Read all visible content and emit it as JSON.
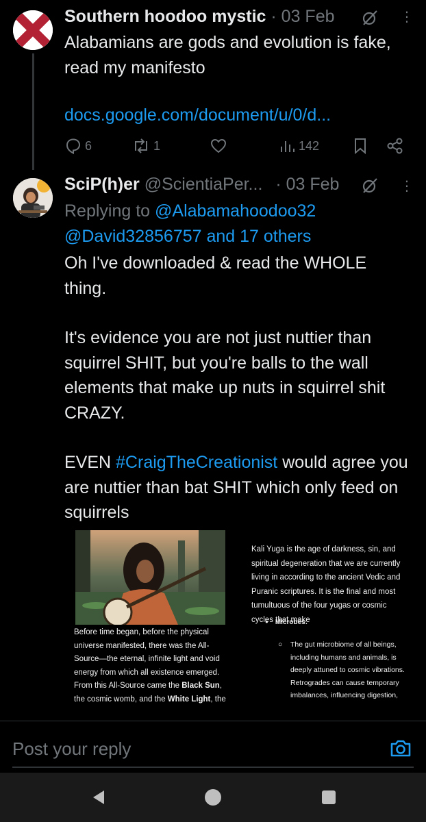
{
  "tweet1": {
    "name": "Southern hoodoo mystic",
    "date": "· 03 Feb",
    "text": "Alabamians are gods and evolution is fake, read my manifesto",
    "link": "docs.google.com/document/u/0/d...",
    "stats": {
      "replies": "6",
      "reposts": "1",
      "views": "142"
    }
  },
  "tweet2": {
    "name": "SciP(h)er",
    "handle": "@ScientiaPer...",
    "date": "· 03 Feb",
    "replying_prefix": "Replying to",
    "replying_to": "@Alabamahoodoo32",
    "replying_more": "@David32856757 and 17 others",
    "body": {
      "p1": "Oh I've downloaded & read the WHOLE thing.",
      "p2": "It's evidence you are not just nuttier than squirrel SHIT, but you're balls to the wall elements that make up nuts in squirrel shit CRAZY.",
      "p3_pre": "EVEN ",
      "hashtag": "#CraigTheCreationist",
      "p3_post": " would agree you are nuttier than bat SHIT which only feed on squirrels"
    }
  },
  "attachment": {
    "left_text_1": "Before time began, before the physical universe manifested, there was the All-Source—the eternal, infinite light and void energy from which all existence emerged. From this All-Source came the ",
    "left_bold_1": "Black Sun",
    "left_text_2": ", the cosmic womb, and the ",
    "left_bold_2": "White Light",
    "left_text_3": ", the",
    "right_text": "Kali Yuga is the age of darkness, sin, and spiritual degeneration that we are currently living in according to the ancient Vedic and Puranic scriptures. It is the final and most tumultuous of the four yugas or cosmic cycles that make",
    "sub_heading": "Microbes:",
    "sub_text": "The gut microbiome of all beings, including humans and animals, is deeply attuned to cosmic vibrations. Retrogrades can cause temporary imbalances, influencing digestion,"
  },
  "reply_bar": {
    "placeholder": "Post your reply"
  },
  "colors": {
    "background": "#000000",
    "text": "#e7e9ea",
    "secondary": "#71767b",
    "accent": "#1d9bf0"
  },
  "icons": [
    "reply-icon",
    "repost-icon",
    "like-icon",
    "views-icon",
    "bookmark-icon",
    "share-icon",
    "grok-icon",
    "more-icon",
    "camera-icon",
    "back-icon",
    "home-icon",
    "recents-icon"
  ]
}
